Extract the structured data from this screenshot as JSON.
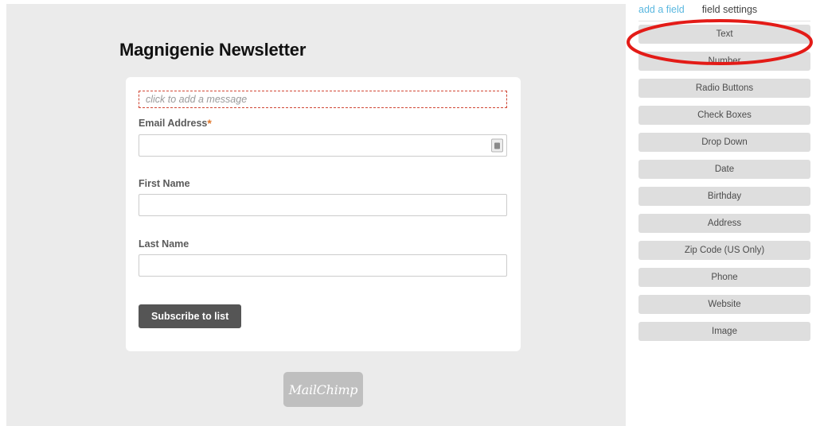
{
  "preview": {
    "form_title": "Magnigenie Newsletter",
    "message_placeholder": "click to add a message",
    "fields": [
      {
        "label": "Email Address",
        "required": true,
        "value": "",
        "icon": "autofill-contact-icon"
      },
      {
        "label": "First Name",
        "required": false,
        "value": ""
      },
      {
        "label": "Last Name",
        "required": false,
        "value": ""
      }
    ],
    "submit_label": "Subscribe to list",
    "footer_logo": "MailChimp"
  },
  "sidebar": {
    "tabs": [
      {
        "label": "add a field",
        "active": true
      },
      {
        "label": "field settings",
        "active": false
      }
    ],
    "field_types": [
      "Text",
      "Number",
      "Radio Buttons",
      "Check Boxes",
      "Drop Down",
      "Date",
      "Birthday",
      "Address",
      "Zip Code (US Only)",
      "Phone",
      "Website",
      "Image"
    ]
  },
  "annotation": {
    "shape": "ellipse",
    "target": "Text",
    "color": "#e31b17"
  },
  "colors": {
    "canvas": "#ebebeb",
    "card": "#ffffff",
    "button": "#555555",
    "link": "#5bb8e0",
    "field_type_button": "#dedede",
    "required_star": "#e0762a",
    "placeholder_border": "#d14836"
  }
}
